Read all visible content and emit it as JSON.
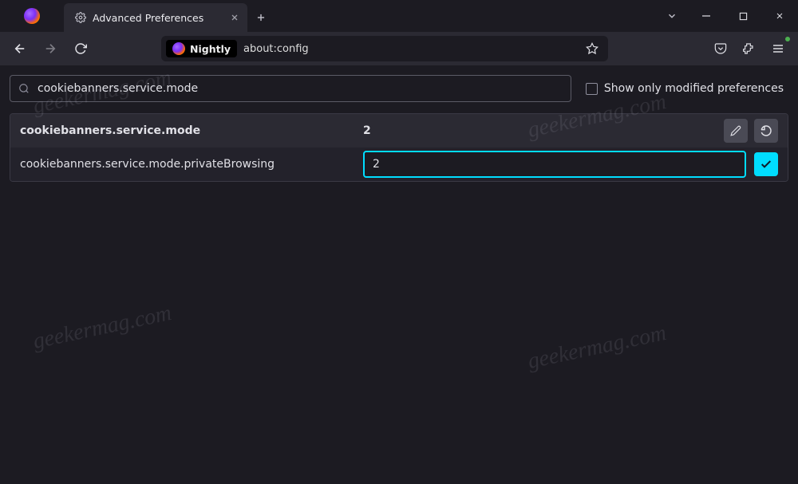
{
  "window": {
    "tab_title": "Advanced Preferences"
  },
  "urlbar": {
    "brand": "Nightly",
    "url": "about:config"
  },
  "search": {
    "value": "cookiebanners.service.mode",
    "filter_label": "Show only modified preferences"
  },
  "prefs": [
    {
      "name": "cookiebanners.service.mode",
      "value": "2",
      "modified": true,
      "editing": false
    },
    {
      "name": "cookiebanners.service.mode.privateBrowsing",
      "value": "2",
      "modified": false,
      "editing": true
    }
  ],
  "watermark": "geekermag.com"
}
